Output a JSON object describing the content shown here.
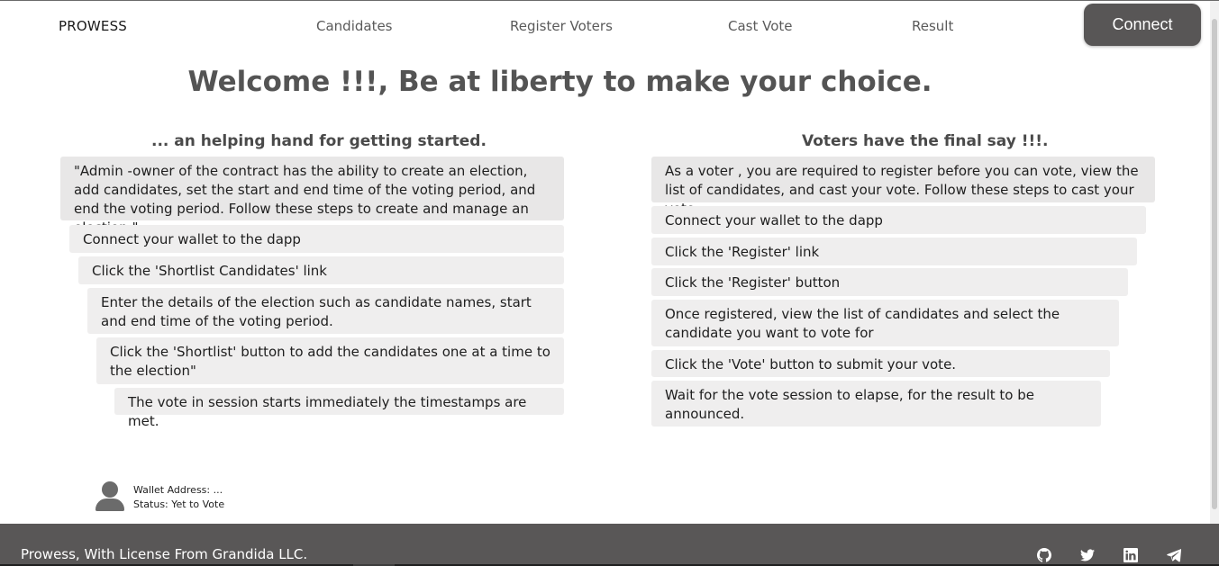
{
  "nav": {
    "brand": "PROWESS",
    "links": [
      "Candidates",
      "Register Voters",
      "Cast Vote",
      "Result"
    ],
    "connect": "Connect"
  },
  "welcome": "Welcome !!!, Be at liberty to make your choice.",
  "admin": {
    "title": "... an helping hand for getting started.",
    "intro": "\"Admin -owner of the contract has the ability to create an election, add candidates, set the start and end time of the voting period, and end the voting period. Follow these steps to create and manage an election:\"",
    "steps": [
      "Connect your wallet to the dapp",
      "Click the 'Shortlist Candidates' link",
      "Enter the details of the election such as candidate names, start and end time of the voting period.",
      "Click the 'Shortlist' button to add the candidates one at a time to the election\"",
      "The vote in session starts immediately the timestamps are met."
    ]
  },
  "voter": {
    "title": "Voters have the final say !!!.",
    "intro": "As a voter , you are required to register before you can vote, view the list of candidates, and cast your vote. Follow these steps to cast your vote:",
    "steps": [
      "Connect your wallet to the dapp",
      "Click the 'Register' link",
      "Click the 'Register' button",
      "Once registered, view the list of candidates and select the candidate you want to vote for",
      "Click the 'Vote' button to submit your vote.",
      "Wait for the vote session to elapse, for the result to be announced."
    ]
  },
  "user": {
    "wallet": "Wallet Address: ...",
    "status": "Status: Yet to Vote"
  },
  "footer": {
    "text": "Prowess, With License From Grandida LLC.",
    "icons": [
      "github-icon",
      "twitter-icon",
      "linkedin-icon",
      "telegram-icon"
    ]
  }
}
